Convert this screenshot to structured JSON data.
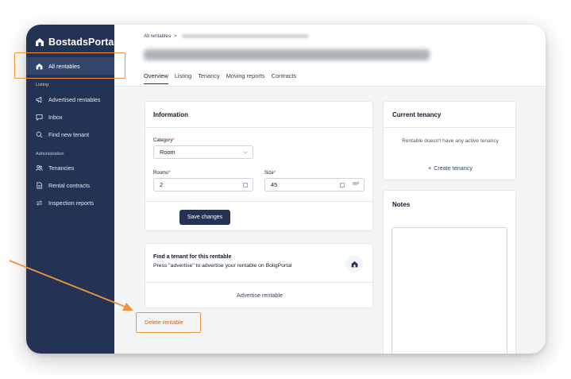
{
  "brand": {
    "name": "BostadsPortal"
  },
  "sidebar": {
    "top_item": {
      "label": "All rentables",
      "icon": "home-icon"
    },
    "sections": [
      {
        "label": "Listing",
        "items": [
          {
            "label": "Advertised rentables",
            "icon": "megaphone-icon"
          },
          {
            "label": "Inbox",
            "icon": "chat-icon"
          },
          {
            "label": "Find new tenant",
            "icon": "search-icon"
          }
        ]
      },
      {
        "label": "Administration",
        "items": [
          {
            "label": "Tenancies",
            "icon": "users-icon"
          },
          {
            "label": "Rental contracts",
            "icon": "document-icon"
          },
          {
            "label": "Inspection reports",
            "icon": "swap-icon"
          }
        ]
      }
    ]
  },
  "header": {
    "breadcrumb_root": "All rentables",
    "breadcrumb_sep": ">",
    "tabs": [
      {
        "label": "Overview",
        "active": true
      },
      {
        "label": "Listing"
      },
      {
        "label": "Tenancy"
      },
      {
        "label": "Moving reports"
      },
      {
        "label": "Contracts"
      }
    ]
  },
  "info": {
    "title": "Information",
    "category_label": "Category",
    "category_value": "Room",
    "rooms_label": "Rooms",
    "rooms_value": "2",
    "size_label": "Size",
    "size_value": "45",
    "size_unit": "m²",
    "required_mark": "*",
    "save_label": "Save changes"
  },
  "tenant_card": {
    "title": "Find a tenant for this rentable",
    "description": "Press \"advertise\" to advertise your rentable on BoligPortal",
    "action_label": "Advertise rentable"
  },
  "delete_label": "Delete rentable",
  "current_tenancy": {
    "title": "Current tenancy",
    "empty_text": "Rentable doesn't have any active tenancy",
    "create_label": "Create tenancy",
    "plus": "+"
  },
  "notes": {
    "title": "Notes"
  },
  "colors": {
    "sidebar": "#243253",
    "accent_orange": "#f0953b",
    "delete_red": "#ea580c"
  }
}
